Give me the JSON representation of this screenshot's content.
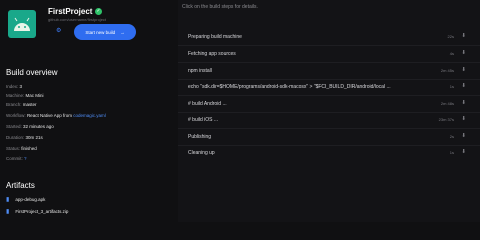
{
  "header": {
    "hint": "Click on the build steps for details.",
    "project_title": "FirstProject",
    "project_subtitle": "github.com/username/firstproject",
    "start_button": "Start new build",
    "start_arrow": "→"
  },
  "overview": {
    "heading": "Build overview",
    "rows": [
      {
        "label": "Index:",
        "value": "3"
      },
      {
        "label": "Machine:",
        "value": "Mac Mini"
      },
      {
        "label": "Branch:",
        "value": "master"
      },
      {
        "label": "Workflow:",
        "value": "React Native App from",
        "link": "codemagic.yaml"
      },
      {
        "label": "Started:",
        "value": "32 minutes ago"
      },
      {
        "label": "Duration:",
        "value": "30m 21s"
      },
      {
        "label": "Status:",
        "value": "finished"
      },
      {
        "label": "Commit:",
        "value": "?"
      }
    ]
  },
  "artifacts": {
    "heading": "Artifacts",
    "items": [
      {
        "name": "app-debug.apk"
      },
      {
        "name": "FirstProject_3_artifacts.zip"
      }
    ]
  },
  "steps": [
    {
      "name": "Preparing build machine",
      "duration": "22s"
    },
    {
      "name": "Fetching app sources",
      "duration": "4s"
    },
    {
      "name": "npm install",
      "duration": "2m 45s"
    },
    {
      "name": "echo \"sdk.dir=$HOME/programs/android-sdk-macosx\" > \"$FCI_BUILD_DIR/android/local ...",
      "duration": "1s"
    },
    {
      "name": "# build Android ...",
      "duration": "2m 48s"
    },
    {
      "name": "# build iOS ...",
      "duration": "23m 37s"
    },
    {
      "name": "Publishing",
      "duration": "2s"
    },
    {
      "name": "Cleaning up",
      "duration": "1s"
    }
  ],
  "icons": {
    "download": "⬇",
    "file": "▮"
  },
  "colors": {
    "accent": "#2f6df0",
    "link": "#4f8df7",
    "app_icon_bg": "#19a88a",
    "verified": "#2fc46a"
  }
}
